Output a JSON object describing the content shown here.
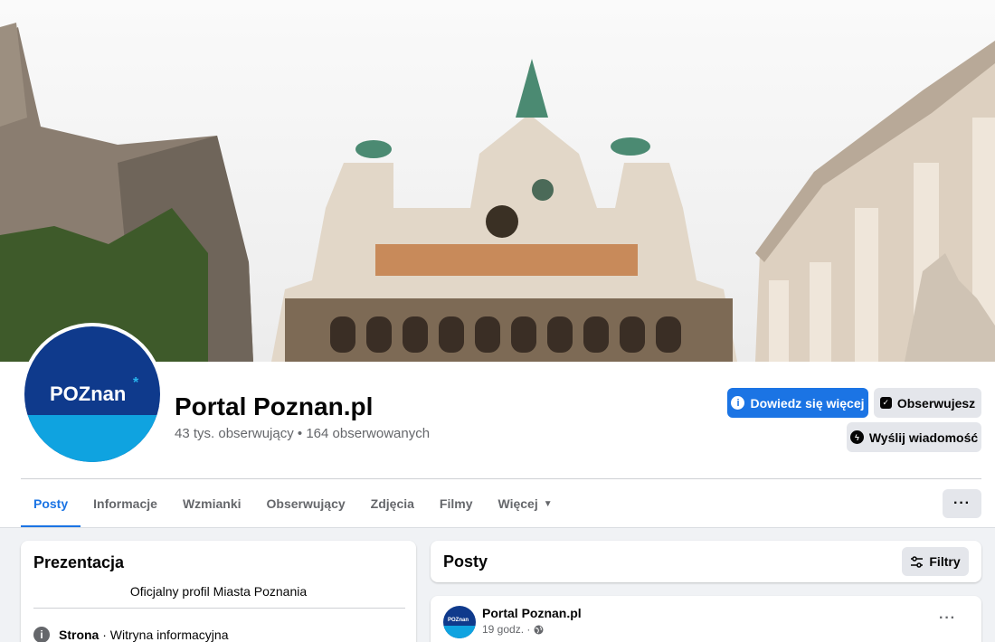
{
  "colors": {
    "accent": "#1b74e4",
    "button_gray": "#e4e6eb",
    "secondary_text": "#65676b",
    "page_bg": "#f0f2f5",
    "logo_dark_blue": "#0f3a8c",
    "logo_light_blue": "#0fa3e0"
  },
  "cover": {
    "icon": "city-hall-photo"
  },
  "profile": {
    "avatar_text": "POZnan",
    "avatar_star": "*",
    "name": "Portal Poznan.pl",
    "stats": "43 tys. obserwujący • 164 obserwowanych"
  },
  "actions": {
    "learn_more": {
      "label": "Dowiedz się więcej",
      "icon": "info-icon"
    },
    "following": {
      "label": "Obserwujesz",
      "icon": "check-box-icon"
    },
    "message": {
      "label": "Wyślij wiadomość",
      "icon": "messenger-icon"
    }
  },
  "tabs": [
    {
      "label": "Posty",
      "active": true
    },
    {
      "label": "Informacje"
    },
    {
      "label": "Wzmianki"
    },
    {
      "label": "Obserwujący"
    },
    {
      "label": "Zdjęcia"
    },
    {
      "label": "Filmy"
    },
    {
      "label": "Więcej"
    }
  ],
  "tabs_more_dots": "···",
  "intro": {
    "title": "Prezentacja",
    "text": "Oficjalny profil Miasta Poznania",
    "info_strong": "Strona",
    "info_rest": " · Witryna informacyjna"
  },
  "posts_header": {
    "title": "Posty",
    "filter_label": "Filtry"
  },
  "post": {
    "author": "Portal Poznan.pl",
    "avatar_text": "POZnan",
    "time": "19 godz. ·",
    "dots": "···"
  }
}
